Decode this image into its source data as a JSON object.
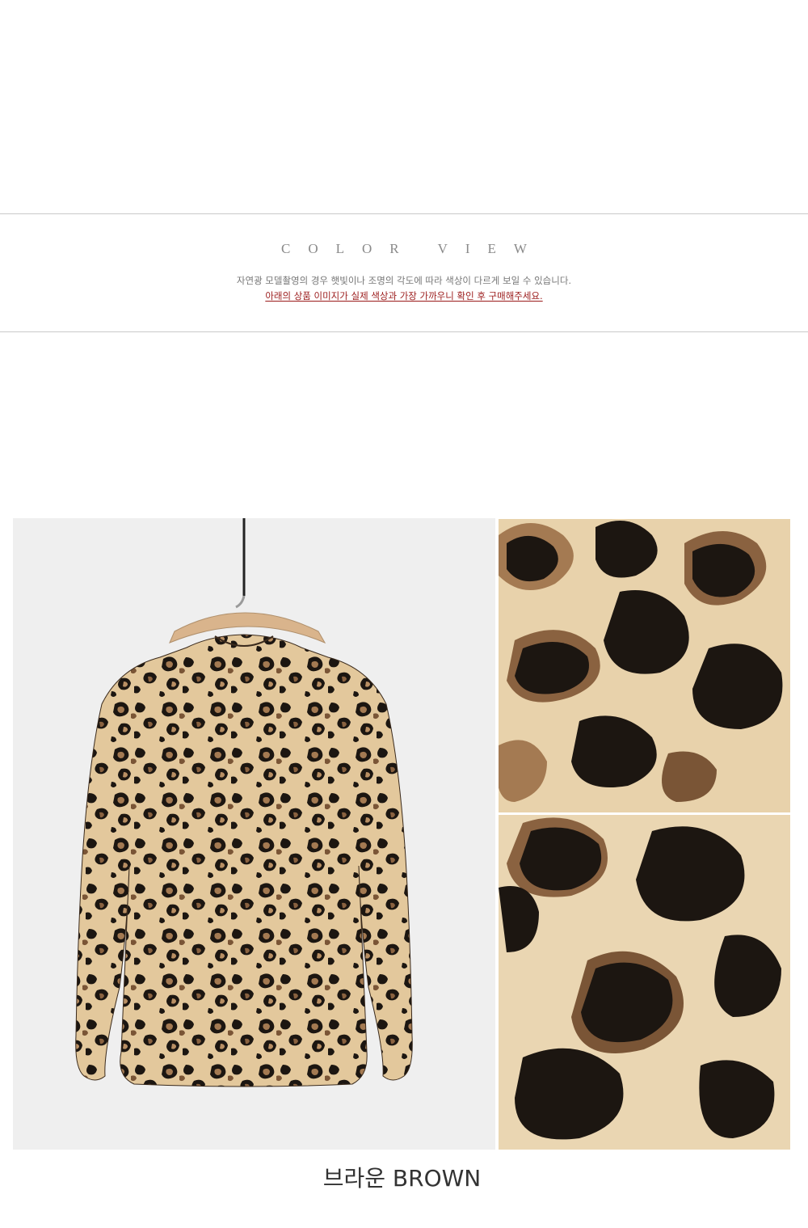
{
  "section": {
    "heading": "COLOR VIEW",
    "notice_line1": "자연광 모델촬영의 경우 햇빛이나 조명의 각도에 따라 색상이 다르게 보일 수 있습니다.",
    "notice_line2": "아래의 상품 이미지가 실제 색상과 가장 가까우니 확인 후 구매해주세요."
  },
  "product": {
    "color_caption": "브라운 BROWN",
    "colors": {
      "cream": "#e8d2ab",
      "tan": "#b98f63",
      "brown": "#7a5536",
      "black": "#1c1611",
      "background": "#ececec"
    }
  }
}
